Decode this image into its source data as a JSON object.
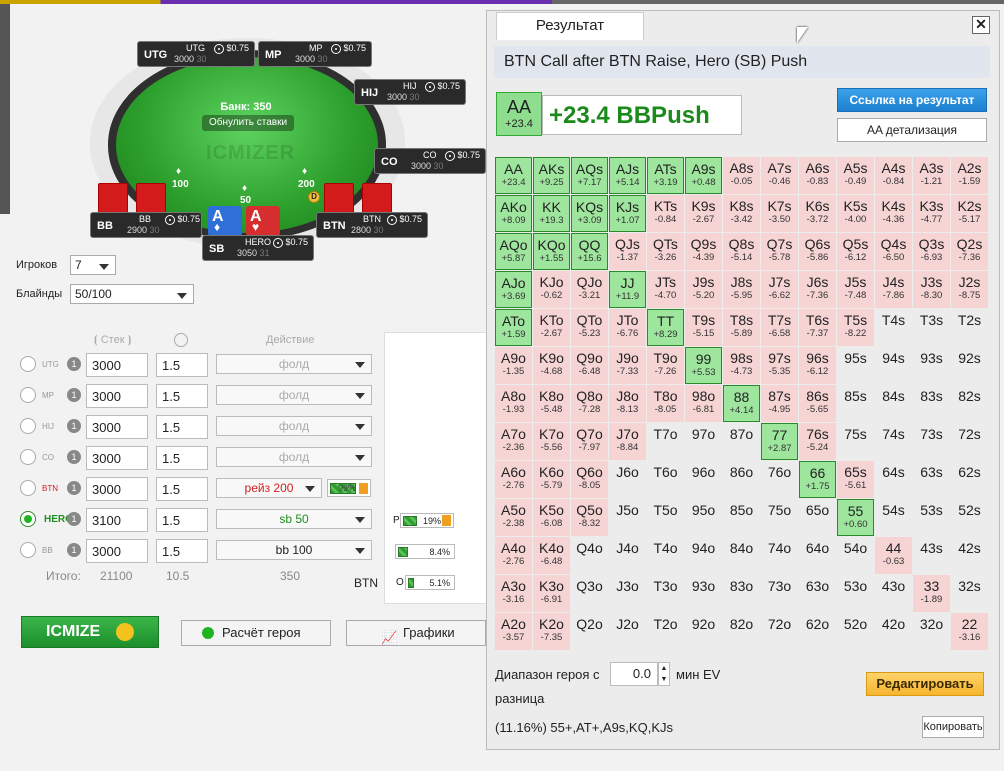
{
  "table": {
    "bank_label": "Банк: 350",
    "reset_label": "Обнулить ставки",
    "watermark": "ICMIZER",
    "chips": {
      "sb": "50",
      "bb": "100",
      "btn": "200"
    },
    "dealer": "D",
    "seats": [
      {
        "pos": "UTG",
        "name": "UTG",
        "stack": "3000",
        "bb": "30",
        "money": "$0.75"
      },
      {
        "pos": "MP",
        "name": "MP",
        "stack": "3000",
        "bb": "30",
        "money": "$0.75"
      },
      {
        "pos": "HIJ",
        "name": "HIJ",
        "stack": "3000",
        "bb": "30",
        "money": "$0.75"
      },
      {
        "pos": "CO",
        "name": "CO",
        "stack": "3000",
        "bb": "30",
        "money": "$0.75"
      },
      {
        "pos": "BTN",
        "name": "BTN",
        "stack": "2800",
        "bb": "30",
        "money": "$0.75"
      },
      {
        "pos": "SB",
        "name": "HERO",
        "stack": "3050",
        "bb": "31",
        "money": "$0.75"
      },
      {
        "pos": "BB",
        "name": "BB",
        "stack": "2900",
        "bb": "30",
        "money": "$0.75"
      }
    ],
    "hero_cards": [
      "A",
      "A"
    ]
  },
  "controls": {
    "players_label": "Игроков",
    "players_value": "7",
    "blinds_label": "Блайнды",
    "blinds_value": "50/100",
    "col_stack": "Стек",
    "col_action": "Действие",
    "rows": [
      {
        "pos": "UTG",
        "num": "1",
        "stack": "3000",
        "bounty": "1.5",
        "action": "фолд",
        "active": false,
        "hero": false,
        "action_color": "#aaaaaa"
      },
      {
        "pos": "MP",
        "num": "1",
        "stack": "3000",
        "bounty": "1.5",
        "action": "фолд",
        "active": false,
        "hero": false,
        "action_color": "#aaaaaa"
      },
      {
        "pos": "HIJ",
        "num": "1",
        "stack": "3000",
        "bounty": "1.5",
        "action": "фолд",
        "active": false,
        "hero": false,
        "action_color": "#aaaaaa"
      },
      {
        "pos": "CO",
        "num": "1",
        "stack": "3000",
        "bounty": "1.5",
        "action": "фолд",
        "active": false,
        "hero": false,
        "action_color": "#aaaaaa"
      },
      {
        "pos": "BTN",
        "num": "1",
        "stack": "3000",
        "bounty": "1.5",
        "action": "рейз 200",
        "active": false,
        "hero": false,
        "action_color": "#d42020"
      },
      {
        "pos": "HERO",
        "num": "1",
        "stack": "3100",
        "bounty": "1.5",
        "action": "sb 50",
        "active": true,
        "hero": true,
        "action_color": "#1f8f1f"
      },
      {
        "pos": "BB",
        "num": "1",
        "stack": "3000",
        "bounty": "1.5",
        "action": "bb 100",
        "active": false,
        "hero": false,
        "action_color": "#222222"
      }
    ],
    "btn_range_pct": "99%",
    "total_label": "Итого:",
    "total_stack": "21100",
    "total_bounty": "10.5",
    "total_action": "350"
  },
  "side": {
    "p_label": "P",
    "p_pct": "19%",
    "bar1_pct": "8.4%",
    "o_label": "O",
    "o_pct": "5.1%",
    "btn_label": "BTN"
  },
  "buttons": {
    "icmize": "ICMIZE",
    "hero_calc": "Расчёт героя",
    "charts": "Графики"
  },
  "result": {
    "tab_title": "Результат",
    "close": "✕",
    "title": "BTN Call after BTN Raise, Hero (SB) Push",
    "hand": "AA",
    "hand_ev": "+23.4",
    "headline": "+23.4 BBPush",
    "link_button": "Ссылка на результат",
    "detail_button": "AA детализация",
    "range_label_1": "Диапазон героя с",
    "range_value": "0.0",
    "range_label_2": "мин EV",
    "range_label_3": "разница",
    "edit_button": "Редактировать",
    "summary": "(11.16%) 55+,AT+,A9s,KQ,KJs",
    "copy_button": "Копировать",
    "grid": [
      [
        [
          "AA",
          "+23.4",
          "push"
        ],
        [
          "AKs",
          "+9.25",
          "push"
        ],
        [
          "AQs",
          "+7.17",
          "push"
        ],
        [
          "AJs",
          "+5.14",
          "push"
        ],
        [
          "ATs",
          "+3.19",
          "push"
        ],
        [
          "A9s",
          "+0.48",
          "push"
        ],
        [
          "A8s",
          "-0.05",
          "neg"
        ],
        [
          "A7s",
          "-0.46",
          "neg"
        ],
        [
          "A6s",
          "-0.83",
          "neg"
        ],
        [
          "A5s",
          "-0.49",
          "neg"
        ],
        [
          "A4s",
          "-0.84",
          "neg"
        ],
        [
          "A3s",
          "-1.21",
          "neg"
        ],
        [
          "A2s",
          "-1.59",
          "neg"
        ]
      ],
      [
        [
          "AKo",
          "+8.09",
          "push"
        ],
        [
          "KK",
          "+19.3",
          "push"
        ],
        [
          "KQs",
          "+3.09",
          "push"
        ],
        [
          "KJs",
          "+1.07",
          "push"
        ],
        [
          "KTs",
          "-0.84",
          "neg"
        ],
        [
          "K9s",
          "-2.67",
          "neg"
        ],
        [
          "K8s",
          "-3.42",
          "neg"
        ],
        [
          "K7s",
          "-3.50",
          "neg"
        ],
        [
          "K6s",
          "-3.72",
          "neg"
        ],
        [
          "K5s",
          "-4.00",
          "neg"
        ],
        [
          "K4s",
          "-4.36",
          "neg"
        ],
        [
          "K3s",
          "-4.77",
          "neg"
        ],
        [
          "K2s",
          "-5.17",
          "neg"
        ]
      ],
      [
        [
          "AQo",
          "+5.87",
          "push"
        ],
        [
          "KQo",
          "+1.55",
          "push"
        ],
        [
          "QQ",
          "+15.6",
          "push"
        ],
        [
          "QJs",
          "-1.37",
          "neg"
        ],
        [
          "QTs",
          "-3.26",
          "neg"
        ],
        [
          "Q9s",
          "-4.39",
          "neg"
        ],
        [
          "Q8s",
          "-5.14",
          "neg"
        ],
        [
          "Q7s",
          "-5.78",
          "neg"
        ],
        [
          "Q6s",
          "-5.86",
          "neg"
        ],
        [
          "Q5s",
          "-6.12",
          "neg"
        ],
        [
          "Q4s",
          "-6.50",
          "neg"
        ],
        [
          "Q3s",
          "-6.93",
          "neg"
        ],
        [
          "Q2s",
          "-7.36",
          "neg"
        ]
      ],
      [
        [
          "AJo",
          "+3.69",
          "push"
        ],
        [
          "KJo",
          "-0.62",
          "neg"
        ],
        [
          "QJo",
          "-3.21",
          "neg"
        ],
        [
          "JJ",
          "+11.9",
          "push"
        ],
        [
          "JTs",
          "-4.70",
          "neg"
        ],
        [
          "J9s",
          "-5.20",
          "neg"
        ],
        [
          "J8s",
          "-5.95",
          "neg"
        ],
        [
          "J7s",
          "-6.62",
          "neg"
        ],
        [
          "J6s",
          "-7.36",
          "neg"
        ],
        [
          "J5s",
          "-7.48",
          "neg"
        ],
        [
          "J4s",
          "-7.86",
          "neg"
        ],
        [
          "J3s",
          "-8.30",
          "neg"
        ],
        [
          "J2s",
          "-8.75",
          "neg"
        ]
      ],
      [
        [
          "ATo",
          "+1.59",
          "push"
        ],
        [
          "KTo",
          "-2.67",
          "neg"
        ],
        [
          "QTo",
          "-5.23",
          "neg"
        ],
        [
          "JTo",
          "-6.76",
          "neg"
        ],
        [
          "TT",
          "+8.29",
          "push"
        ],
        [
          "T9s",
          "-5.15",
          "neg"
        ],
        [
          "T8s",
          "-5.89",
          "neg"
        ],
        [
          "T7s",
          "-6.58",
          "neg"
        ],
        [
          "T6s",
          "-7.37",
          "neg"
        ],
        [
          "T5s",
          "-8.22",
          "neg"
        ],
        [
          "T4s",
          "",
          "none"
        ],
        [
          "T3s",
          "",
          "none"
        ],
        [
          "T2s",
          "",
          "none"
        ]
      ],
      [
        [
          "A9o",
          "-1.35",
          "neg"
        ],
        [
          "K9o",
          "-4.68",
          "neg"
        ],
        [
          "Q9o",
          "-6.48",
          "neg"
        ],
        [
          "J9o",
          "-7.33",
          "neg"
        ],
        [
          "T9o",
          "-7.26",
          "neg"
        ],
        [
          "99",
          "+5.53",
          "push"
        ],
        [
          "98s",
          "-4.73",
          "neg"
        ],
        [
          "97s",
          "-5.35",
          "neg"
        ],
        [
          "96s",
          "-6.12",
          "neg"
        ],
        [
          "95s",
          "",
          "none"
        ],
        [
          "94s",
          "",
          "none"
        ],
        [
          "93s",
          "",
          "none"
        ],
        [
          "92s",
          "",
          "none"
        ]
      ],
      [
        [
          "A8o",
          "-1.93",
          "neg"
        ],
        [
          "K8o",
          "-5.48",
          "neg"
        ],
        [
          "Q8o",
          "-7.28",
          "neg"
        ],
        [
          "J8o",
          "-8.13",
          "neg"
        ],
        [
          "T8o",
          "-8.05",
          "neg"
        ],
        [
          "98o",
          "-6.81",
          "neg"
        ],
        [
          "88",
          "+4.14",
          "push"
        ],
        [
          "87s",
          "-4.95",
          "neg"
        ],
        [
          "86s",
          "-5.65",
          "neg"
        ],
        [
          "85s",
          "",
          "none"
        ],
        [
          "84s",
          "",
          "none"
        ],
        [
          "83s",
          "",
          "none"
        ],
        [
          "82s",
          "",
          "none"
        ]
      ],
      [
        [
          "A7o",
          "-2.36",
          "neg"
        ],
        [
          "K7o",
          "-5.56",
          "neg"
        ],
        [
          "Q7o",
          "-7.97",
          "neg"
        ],
        [
          "J7o",
          "-8.84",
          "neg"
        ],
        [
          "T7o",
          "",
          "none"
        ],
        [
          "97o",
          "",
          "none"
        ],
        [
          "87o",
          "",
          "none"
        ],
        [
          "77",
          "+2.87",
          "push"
        ],
        [
          "76s",
          "-5.24",
          "neg"
        ],
        [
          "75s",
          "",
          "none"
        ],
        [
          "74s",
          "",
          "none"
        ],
        [
          "73s",
          "",
          "none"
        ],
        [
          "72s",
          "",
          "none"
        ]
      ],
      [
        [
          "A6o",
          "-2.76",
          "neg"
        ],
        [
          "K6o",
          "-5.79",
          "neg"
        ],
        [
          "Q6o",
          "-8.05",
          "neg"
        ],
        [
          "J6o",
          "",
          "none"
        ],
        [
          "T6o",
          "",
          "none"
        ],
        [
          "96o",
          "",
          "none"
        ],
        [
          "86o",
          "",
          "none"
        ],
        [
          "76o",
          "",
          "none"
        ],
        [
          "66",
          "+1.75",
          "push"
        ],
        [
          "65s",
          "-5.61",
          "neg"
        ],
        [
          "64s",
          "",
          "none"
        ],
        [
          "63s",
          "",
          "none"
        ],
        [
          "62s",
          "",
          "none"
        ]
      ],
      [
        [
          "A5o",
          "-2.38",
          "neg"
        ],
        [
          "K5o",
          "-6.08",
          "neg"
        ],
        [
          "Q5o",
          "-8.32",
          "neg"
        ],
        [
          "J5o",
          "",
          "none"
        ],
        [
          "T5o",
          "",
          "none"
        ],
        [
          "95o",
          "",
          "none"
        ],
        [
          "85o",
          "",
          "none"
        ],
        [
          "75o",
          "",
          "none"
        ],
        [
          "65o",
          "",
          "none"
        ],
        [
          "55",
          "+0.60",
          "push"
        ],
        [
          "54s",
          "",
          "none"
        ],
        [
          "53s",
          "",
          "none"
        ],
        [
          "52s",
          "",
          "none"
        ]
      ],
      [
        [
          "A4o",
          "-2.76",
          "neg"
        ],
        [
          "K4o",
          "-6.48",
          "neg"
        ],
        [
          "Q4o",
          "",
          "none"
        ],
        [
          "J4o",
          "",
          "none"
        ],
        [
          "T4o",
          "",
          "none"
        ],
        [
          "94o",
          "",
          "none"
        ],
        [
          "84o",
          "",
          "none"
        ],
        [
          "74o",
          "",
          "none"
        ],
        [
          "64o",
          "",
          "none"
        ],
        [
          "54o",
          "",
          "none"
        ],
        [
          "44",
          "-0.63",
          "neg"
        ],
        [
          "43s",
          "",
          "none"
        ],
        [
          "42s",
          "",
          "none"
        ]
      ],
      [
        [
          "A3o",
          "-3.16",
          "neg"
        ],
        [
          "K3o",
          "-6.91",
          "neg"
        ],
        [
          "Q3o",
          "",
          "none"
        ],
        [
          "J3o",
          "",
          "none"
        ],
        [
          "T3o",
          "",
          "none"
        ],
        [
          "93o",
          "",
          "none"
        ],
        [
          "83o",
          "",
          "none"
        ],
        [
          "73o",
          "",
          "none"
        ],
        [
          "63o",
          "",
          "none"
        ],
        [
          "53o",
          "",
          "none"
        ],
        [
          "43o",
          "",
          "none"
        ],
        [
          "33",
          "-1.89",
          "neg"
        ],
        [
          "32s",
          "",
          "none"
        ]
      ],
      [
        [
          "A2o",
          "-3.57",
          "neg"
        ],
        [
          "K2o",
          "-7.35",
          "neg"
        ],
        [
          "Q2o",
          "",
          "none"
        ],
        [
          "J2o",
          "",
          "none"
        ],
        [
          "T2o",
          "",
          "none"
        ],
        [
          "92o",
          "",
          "none"
        ],
        [
          "82o",
          "",
          "none"
        ],
        [
          "72o",
          "",
          "none"
        ],
        [
          "62o",
          "",
          "none"
        ],
        [
          "52o",
          "",
          "none"
        ],
        [
          "42o",
          "",
          "none"
        ],
        [
          "32o",
          "",
          "none"
        ],
        [
          "22",
          "-3.16",
          "neg"
        ]
      ]
    ]
  }
}
